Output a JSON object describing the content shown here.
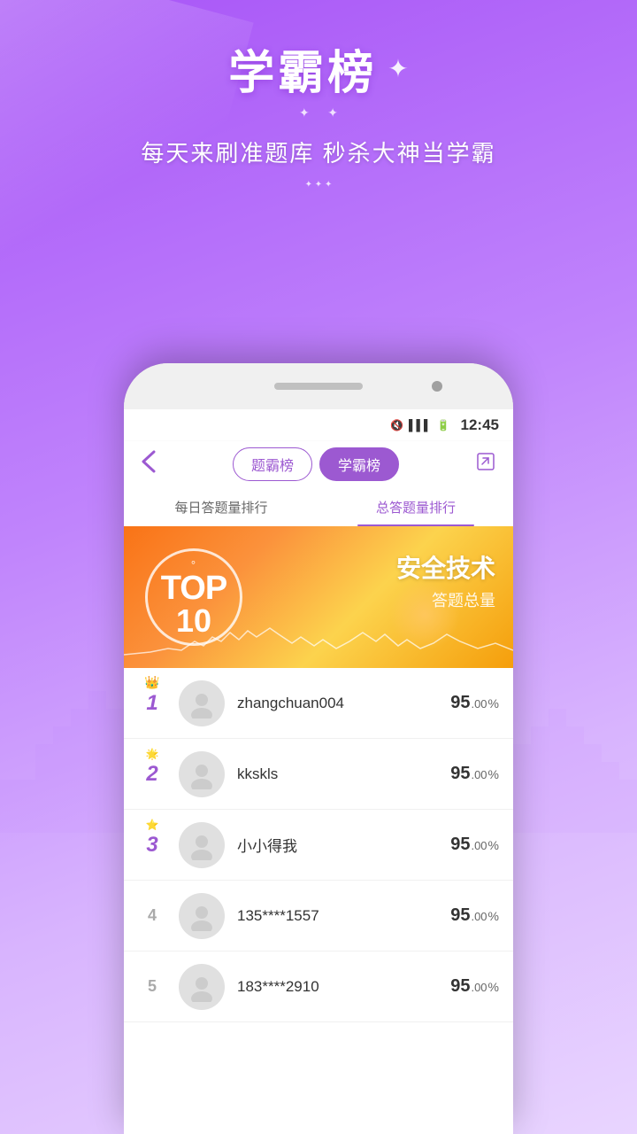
{
  "background": {
    "gradient_start": "#a855f7",
    "gradient_end": "#c084fc"
  },
  "header": {
    "title": "学霸榜",
    "star": "✦",
    "subtitle": "每天来刷准题库 秒杀大神当学霸"
  },
  "status_bar": {
    "icons": "📵 📶 🔋",
    "time": "12:45"
  },
  "nav": {
    "back_icon": "‹",
    "tab1_label": "题霸榜",
    "tab2_label": "学霸榜",
    "share_icon": "↗"
  },
  "sub_tabs": {
    "tab1": "每日答题量排行",
    "tab2": "总答题量排行"
  },
  "banner": {
    "top_degree": "°",
    "top_text": "TOP",
    "top_num": "10",
    "category": "安全技术",
    "label": "答题总量"
  },
  "rankings": [
    {
      "rank": "1",
      "crown": "👑",
      "name": "zhangchuan004",
      "score_main": "95",
      "score_decimal": ".00",
      "score_unit": "%"
    },
    {
      "rank": "2",
      "crown": "🌟",
      "name": "kkskls",
      "score_main": "95",
      "score_decimal": ".00",
      "score_unit": "%"
    },
    {
      "rank": "3",
      "crown": "⭐",
      "name": "小小得我",
      "score_main": "95",
      "score_decimal": ".00",
      "score_unit": "%"
    },
    {
      "rank": "4",
      "crown": "",
      "name": "135****1557",
      "score_main": "95",
      "score_decimal": ".00",
      "score_unit": "%"
    },
    {
      "rank": "5",
      "crown": "",
      "name": "183****2910",
      "score_main": "95",
      "score_decimal": ".00",
      "score_unit": "%"
    }
  ]
}
